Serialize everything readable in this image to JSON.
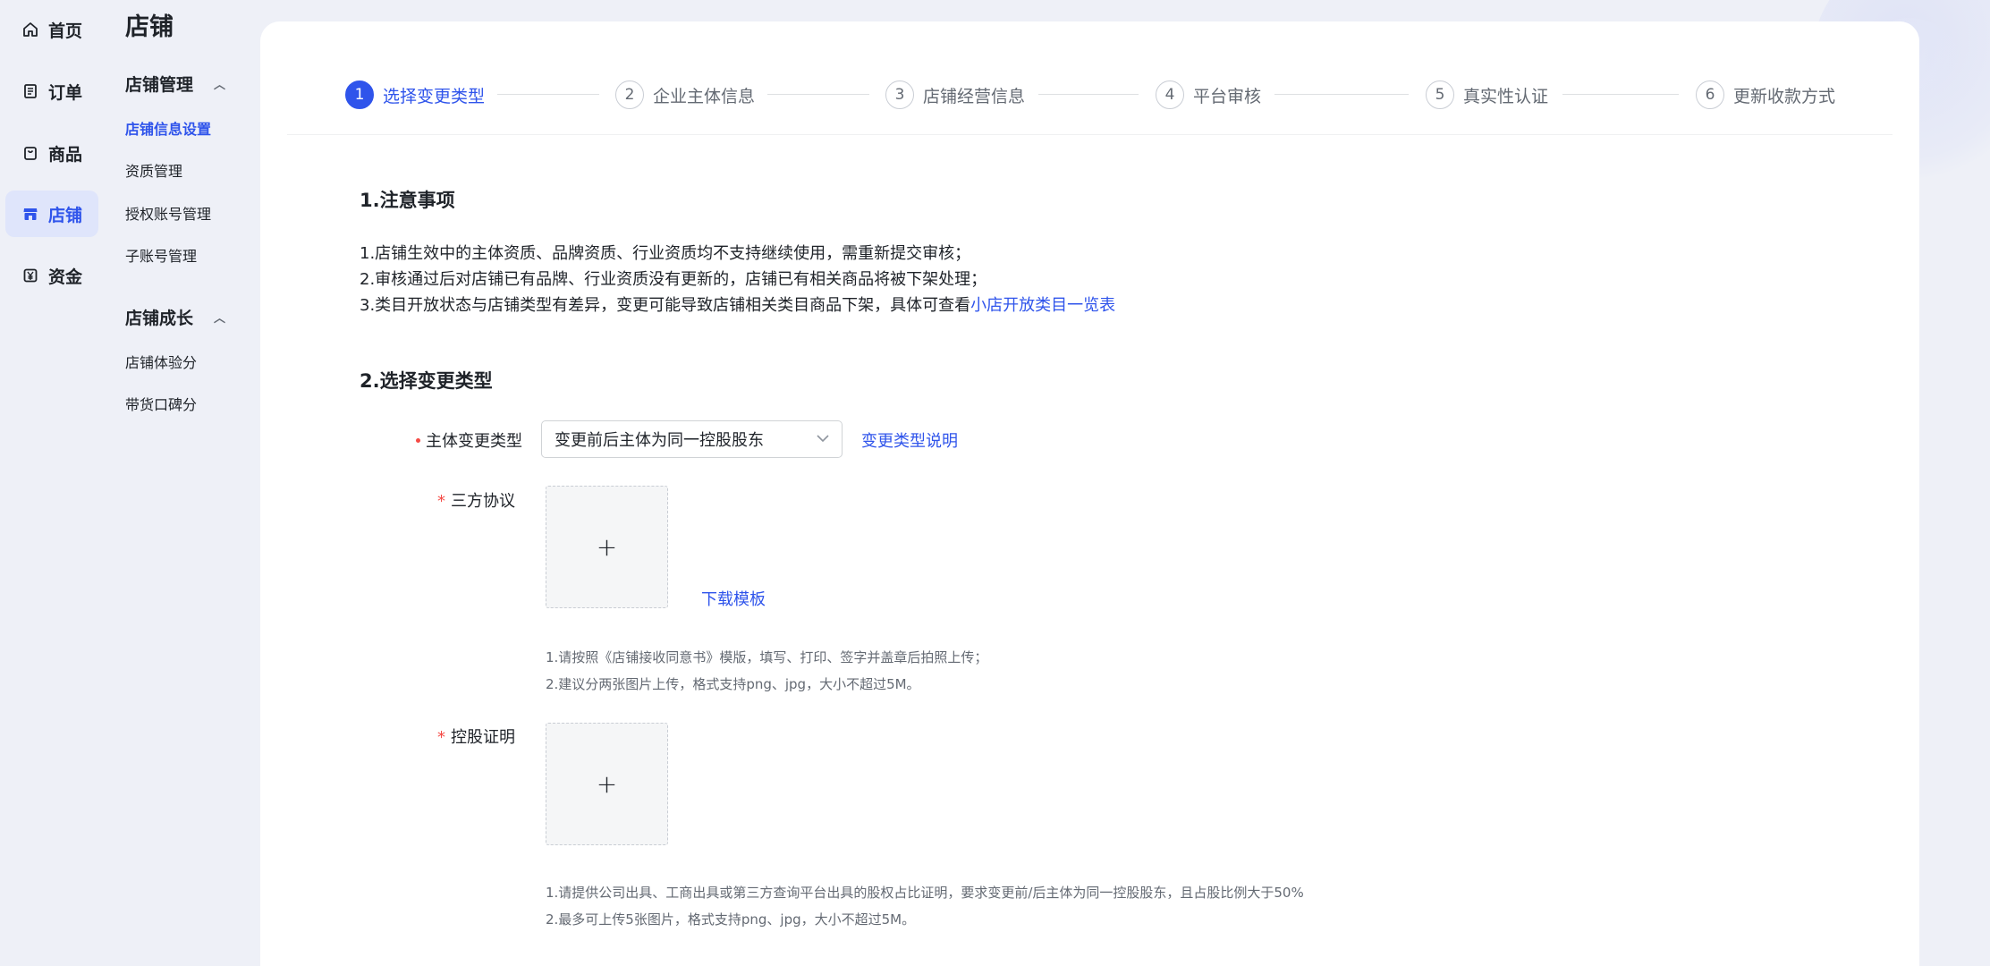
{
  "nav": {
    "items": [
      {
        "label": "首页",
        "icon": "home-icon"
      },
      {
        "label": "订单",
        "icon": "order-icon"
      },
      {
        "label": "商品",
        "icon": "bag-icon"
      },
      {
        "label": "店铺",
        "icon": "store-icon",
        "active": true
      },
      {
        "label": "资金",
        "icon": "yuan-icon"
      }
    ]
  },
  "sub_nav": {
    "title": "店铺",
    "groups": [
      {
        "title": "店铺管理",
        "items": [
          "店铺信息设置",
          "资质管理",
          "授权账号管理",
          "子账号管理"
        ]
      },
      {
        "title": "店铺成长",
        "items": [
          "店铺体验分",
          "带货口碑分"
        ]
      }
    ],
    "active_item": "店铺信息设置"
  },
  "steps": [
    {
      "num": "1",
      "label": "选择变更类型",
      "active": true
    },
    {
      "num": "2",
      "label": "企业主体信息"
    },
    {
      "num": "3",
      "label": "店铺经营信息"
    },
    {
      "num": "4",
      "label": "平台审核"
    },
    {
      "num": "5",
      "label": "真实性认证"
    },
    {
      "num": "6",
      "label": "更新收款方式"
    }
  ],
  "section1": {
    "title": "1.注意事项",
    "notes": [
      "1.店铺生效中的主体资质、品牌资质、行业资质均不支持继续使用，需重新提交审核；",
      "2.审核通过后对店铺已有品牌、行业资质没有更新的，店铺已有相关商品将被下架处理；",
      "3.类目开放状态与店铺类型有差异，变更可能导致店铺相关类目商品下架，具体可查看"
    ],
    "note3_link": "小店开放类目一览表"
  },
  "section2": {
    "title": "2.选择变更类型",
    "change_type": {
      "label": "主体变更类型",
      "value": "变更前后主体为同一控股股东",
      "help_link": "变更类型说明"
    },
    "agreement": {
      "label": "三方协议",
      "download_link": "下载模板",
      "hints": [
        "1.请按照《店铺接收同意书》模版，填写、打印、签字并盖章后拍照上传；",
        "2.建议分两张图片上传，格式支持png、jpg，大小不超过5M。"
      ]
    },
    "holding_proof": {
      "label": "控股证明",
      "hints": [
        "1.请提供公司出具、工商出具或第三方查询平台出具的股权占比证明，要求变更前/后主体为同一控股股东，且占股比例大于50%",
        "2.最多可上传5张图片，格式支持png、jpg，大小不超过5M。"
      ]
    }
  },
  "colors": {
    "accent": "#2f54eb",
    "required": "#f54a45",
    "page_bg": "#eef0f7"
  }
}
